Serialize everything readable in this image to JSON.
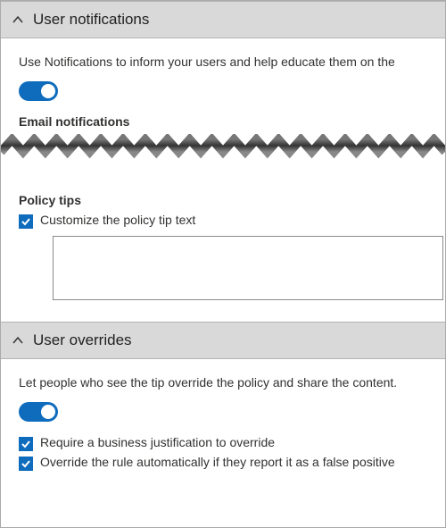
{
  "notifications": {
    "header": "User notifications",
    "description": "Use Notifications to inform your users and help educate them on the",
    "toggle_on": true,
    "email_heading": "Email notifications",
    "policy_tips_heading": "Policy tips",
    "customize_label": "Customize the policy tip text",
    "customize_checked": true,
    "custom_text_value": ""
  },
  "overrides": {
    "header": "User overrides",
    "description": "Let people who see the tip override the policy and share the content.",
    "toggle_on": true,
    "require_justification_label": "Require a business justification to override",
    "require_justification_checked": true,
    "false_positive_label": "Override the rule automatically if they report it as a false positive",
    "false_positive_checked": true
  }
}
